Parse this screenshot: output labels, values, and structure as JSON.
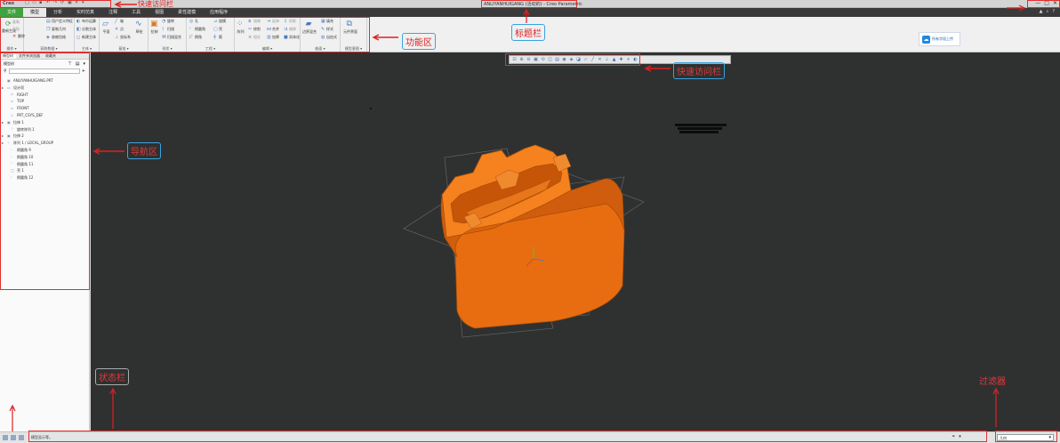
{
  "app": {
    "logo": "Creo",
    "title": "ANLIYANHUIGANG (活动的) - Creo Parametric",
    "window_controls": [
      "—",
      "□",
      "✕"
    ]
  },
  "tabs": [
    {
      "label": "文件"
    },
    {
      "label": "模型"
    },
    {
      "label": "分析"
    },
    {
      "label": "实时仿真"
    },
    {
      "label": "注释"
    },
    {
      "label": "工具"
    },
    {
      "label": "视图"
    },
    {
      "label": "柔性建模"
    },
    {
      "label": "应用程序"
    }
  ],
  "ribbon": {
    "groups": [
      {
        "label": "操作 ▾",
        "items": [
          "重新生成",
          "复制",
          "粘贴",
          "删除"
        ]
      },
      {
        "label": "获取数据 ▾",
        "items": [
          "用户定义特征",
          "复制几何",
          "收缩包络"
        ]
      },
      {
        "label": "主体 ▾",
        "items": [
          "布尔运算",
          "分割主体",
          "新建主体"
        ]
      },
      {
        "label": "基准 ▾",
        "items": [
          "平面",
          "轴",
          "点",
          "坐标系",
          "草绘"
        ]
      },
      {
        "label": "形状 ▾",
        "items": [
          "拉伸",
          "旋转",
          "扫描",
          "扫描混合"
        ]
      },
      {
        "label": "工程 ▾",
        "items": [
          "孔",
          "倒圆角",
          "倒角",
          "拔模",
          "壳",
          "筋"
        ]
      },
      {
        "label": "编辑 ▾",
        "items": [
          "阵列",
          "镜像",
          "延伸",
          "投影",
          "修剪",
          "合并",
          "偏移",
          "相交",
          "加厚",
          "实体化"
        ]
      },
      {
        "label": "曲面 ▾",
        "items": [
          "边界混合",
          "填充",
          "样式",
          "自由式"
        ]
      },
      {
        "label": "模型意图 ▾",
        "items": [
          "元件界面"
        ]
      }
    ],
    "upload_button": "所有字段上传"
  },
  "nav": {
    "tabs": [
      "模型树",
      "文件夹浏览器",
      "收藏夹"
    ],
    "toolbar_label": "模型树",
    "tree": [
      {
        "label": "ANLIYANHUIGANG.PRT",
        "expand": "",
        "icon": "part-icon"
      },
      {
        "label": "设计项",
        "expand": "▸",
        "icon": "folder-icon"
      },
      {
        "label": "RIGHT",
        "expand": "",
        "icon": "plane-icon"
      },
      {
        "label": "TOP",
        "expand": "",
        "icon": "plane-icon"
      },
      {
        "label": "FRONT",
        "expand": "",
        "icon": "plane-icon"
      },
      {
        "label": "PRT_CSYS_DEF",
        "expand": "",
        "icon": "csys-icon"
      },
      {
        "label": "拉伸 1",
        "expand": "▸",
        "icon": "extrude-icon"
      },
      {
        "label": "旋转阵列 1",
        "expand": "",
        "icon": "pattern-icon"
      },
      {
        "label": "拉伸 2",
        "expand": "▸",
        "icon": "extrude-icon"
      },
      {
        "label": "阵列 1 / LOCAL_GROUP",
        "expand": "▸",
        "icon": "pattern-icon"
      },
      {
        "label": "倒圆角 9",
        "expand": "",
        "icon": "round-icon"
      },
      {
        "label": "倒圆角 10",
        "expand": "",
        "icon": "round-icon"
      },
      {
        "label": "倒圆角 11",
        "expand": "",
        "icon": "round-icon"
      },
      {
        "label": "壳 1",
        "expand": "",
        "icon": "shell-icon"
      },
      {
        "label": "倒圆角 12",
        "expand": "",
        "icon": "round-icon"
      }
    ]
  },
  "annotations": {
    "quick_access_bar_top": "快速访问栏",
    "title_bar": "标题栏",
    "ribbon": "功能区",
    "quick_access_bar_graphics": "快速访问栏",
    "navigator": "导航区",
    "status_bar": "状态栏",
    "filter": "过滤器"
  },
  "status": {
    "message": "模型显示等。",
    "filter_value": "几何"
  },
  "colors": {
    "model_orange": "#f07a1a",
    "graphics_bg": "#2f3131",
    "annotation_red": "#e02020",
    "file_tab_green": "#3fa33f"
  }
}
